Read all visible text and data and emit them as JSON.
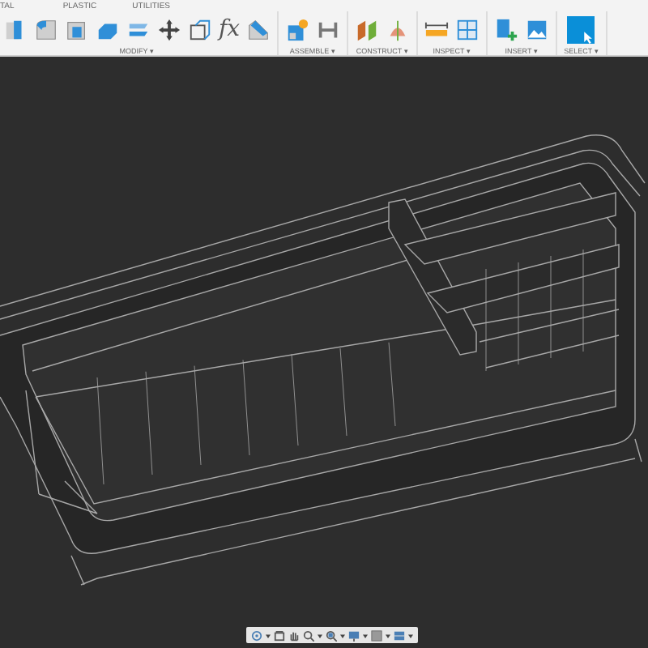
{
  "tabs": [
    {
      "label": "TAL",
      "selected": false
    },
    {
      "label": "PLASTIC",
      "selected": false
    },
    {
      "label": "UTILITIES",
      "selected": false
    }
  ],
  "groups": [
    {
      "label": "MODIFY ▾",
      "tools": [
        {
          "kind": "pressPull"
        },
        {
          "kind": "fillet"
        },
        {
          "kind": "shell"
        },
        {
          "kind": "combine"
        },
        {
          "kind": "offset"
        },
        {
          "kind": "move"
        },
        {
          "kind": "scale"
        },
        {
          "kind": "glyph",
          "text": "fx"
        },
        {
          "kind": "chamfer"
        }
      ]
    },
    {
      "label": "ASSEMBLE ▾",
      "tools": [
        {
          "kind": "component"
        },
        {
          "kind": "joint"
        }
      ]
    },
    {
      "label": "CONSTRUCT ▾",
      "tools": [
        {
          "kind": "plane"
        },
        {
          "kind": "axis"
        }
      ]
    },
    {
      "label": "INSPECT ▾",
      "tools": [
        {
          "kind": "measure"
        },
        {
          "kind": "section"
        }
      ]
    },
    {
      "label": "INSERT ▾",
      "tools": [
        {
          "kind": "insertMesh"
        },
        {
          "kind": "canvas"
        }
      ]
    },
    {
      "label": "SELECT ▾",
      "tools": [
        {
          "kind": "select"
        }
      ]
    }
  ],
  "navbar": [
    {
      "kind": "orbit"
    },
    {
      "kind": "caret"
    },
    {
      "kind": "look"
    },
    {
      "kind": "pan"
    },
    {
      "kind": "zoom"
    },
    {
      "kind": "caret"
    },
    {
      "kind": "fit"
    },
    {
      "kind": "caret"
    },
    {
      "kind": "display"
    },
    {
      "kind": "caret"
    },
    {
      "kind": "grid"
    },
    {
      "kind": "caret"
    },
    {
      "kind": "viewports"
    },
    {
      "kind": "caret"
    }
  ]
}
